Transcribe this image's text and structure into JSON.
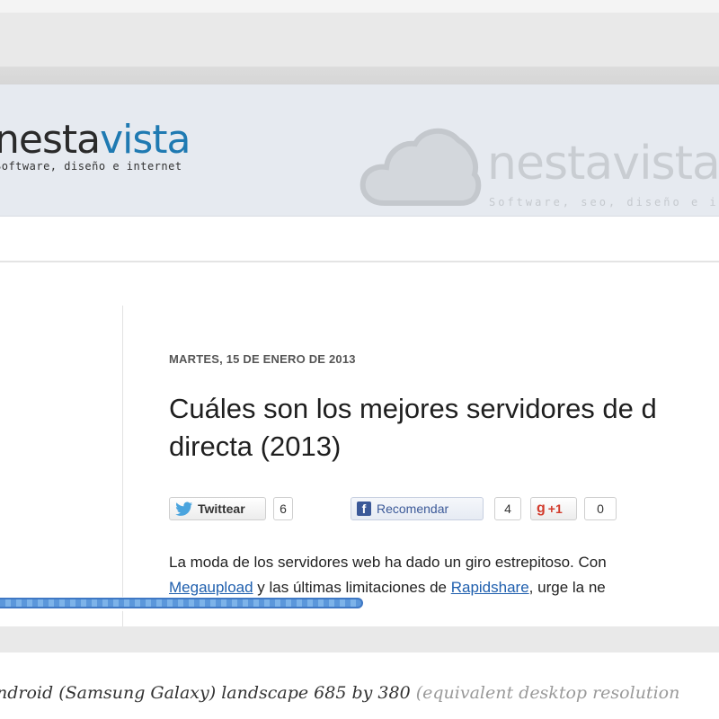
{
  "site": {
    "logo_left": "nesta",
    "logo_right": "vista",
    "tagline": "Software, diseño e internet",
    "watermark_name": "nestavista",
    "watermark_tagline": "Software, seo, diseño e interne"
  },
  "post": {
    "date": "MARTES, 15 DE ENERO DE 2013",
    "title": "Cuáles son los mejores servidores de d directa (2013)",
    "body_line_1": "La moda de los servidores web ha dado un giro estrepitoso. Con",
    "body_line_2": {
      "link_1": "Megaupload",
      "text_1": " y las últimas limitaciones de ",
      "link_2": "Rapidshare",
      "text_2": ", urge la ne"
    }
  },
  "share": {
    "tweet_label": "Twittear",
    "tweet_count": "6",
    "like_label": "Recomendar",
    "like_count": "4",
    "gplus_label": "+1",
    "gplus_count": "0"
  },
  "caption": {
    "main": "ndroid (Samsung Galaxy) landscape 685 by 380",
    "extra": " (equivalent desktop resolution"
  },
  "colors": {
    "brand_blue": "#1f7ab2",
    "link": "#1f5fae",
    "scroll_thumb": "#5b97db"
  },
  "icons": [
    "twitter-bird-icon",
    "facebook-f-icon",
    "google-plus-icon",
    "cloud-icon"
  ]
}
